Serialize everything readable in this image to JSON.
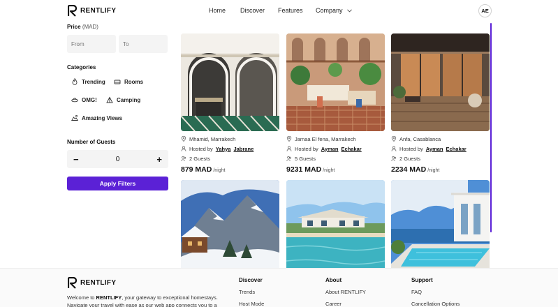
{
  "brand": {
    "name": "RENTLIFY",
    "accent": "#5b21d6"
  },
  "nav": {
    "items": [
      {
        "label": "Home"
      },
      {
        "label": "Discover"
      },
      {
        "label": "Features"
      },
      {
        "label": "Company"
      }
    ],
    "avatar_initials": "AE"
  },
  "filters": {
    "price_title": "Price",
    "price_unit": "(MAD)",
    "from_placeholder": "From",
    "to_placeholder": "To",
    "categories_title": "Categories",
    "categories": [
      {
        "label": "Trending",
        "icon": "flame-icon"
      },
      {
        "label": "Rooms",
        "icon": "bed-icon"
      },
      {
        "label": "OMG!",
        "icon": "ufo-icon"
      },
      {
        "label": "Camping",
        "icon": "tent-icon"
      },
      {
        "label": "Amazing Views",
        "icon": "view-icon"
      }
    ],
    "guests_title": "Number of Guests",
    "guests_value": "0",
    "minus": "−",
    "plus": "+",
    "apply_label": "Apply Filters"
  },
  "listings": [
    {
      "location": "Mhamid, Marrakech",
      "hosted_by": "Hosted by",
      "host_first": "Yahya",
      "host_last": "Jabrane",
      "guests": "2 Guests",
      "price": "879 MAD",
      "per": "/night",
      "image": "riad-courtyard"
    },
    {
      "location": "Jamaa El fena, Marrakech",
      "hosted_by": "Hosted by",
      "host_first": "Ayman",
      "host_last": "Echakar",
      "guests": "5 Guests",
      "price": "9231 MAD",
      "per": "/night",
      "image": "riad-patio-plants"
    },
    {
      "location": "Anfa, Casablanca",
      "hosted_by": "Hosted by",
      "host_first": "Ayman",
      "host_last": "Echakar",
      "guests": "2 Guests",
      "price": "2234 MAD",
      "per": "/night",
      "image": "modern-terrace"
    },
    {
      "image": "snowy-mountain-chalet"
    },
    {
      "image": "beach-house"
    },
    {
      "image": "cliff-pool-villa"
    }
  ],
  "footer": {
    "brand": "RENTLIFY",
    "desc_prefix": "Welcome to ",
    "desc_brand": "RENTLIFY",
    "desc_rest": ", your gateway to exceptional homestays. Navigate your travel with ease as our web app connects you to a",
    "columns": [
      {
        "title": "Discover",
        "links": [
          "Trends",
          "Host Mode"
        ]
      },
      {
        "title": "About",
        "links": [
          "About RENTLIFY",
          "Career"
        ]
      },
      {
        "title": "Support",
        "links": [
          "FAQ",
          "Cancellation Options"
        ]
      }
    ]
  }
}
